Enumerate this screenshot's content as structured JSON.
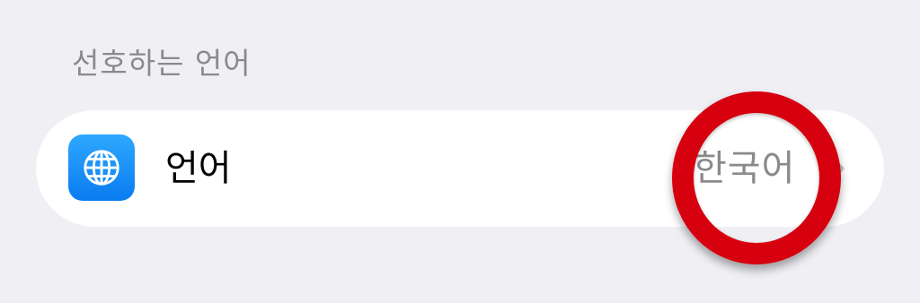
{
  "section": {
    "header": "선호하는 언어"
  },
  "language_row": {
    "icon": "globe-icon",
    "label": "언어",
    "value": "한국어",
    "accessory": "chevron-right-icon"
  },
  "colors": {
    "background": "#efeff4",
    "row_background": "#ffffff",
    "icon_blue": "#1a8cff",
    "secondary_text": "#8a8a8e",
    "annotation_red": "#d6000f"
  }
}
